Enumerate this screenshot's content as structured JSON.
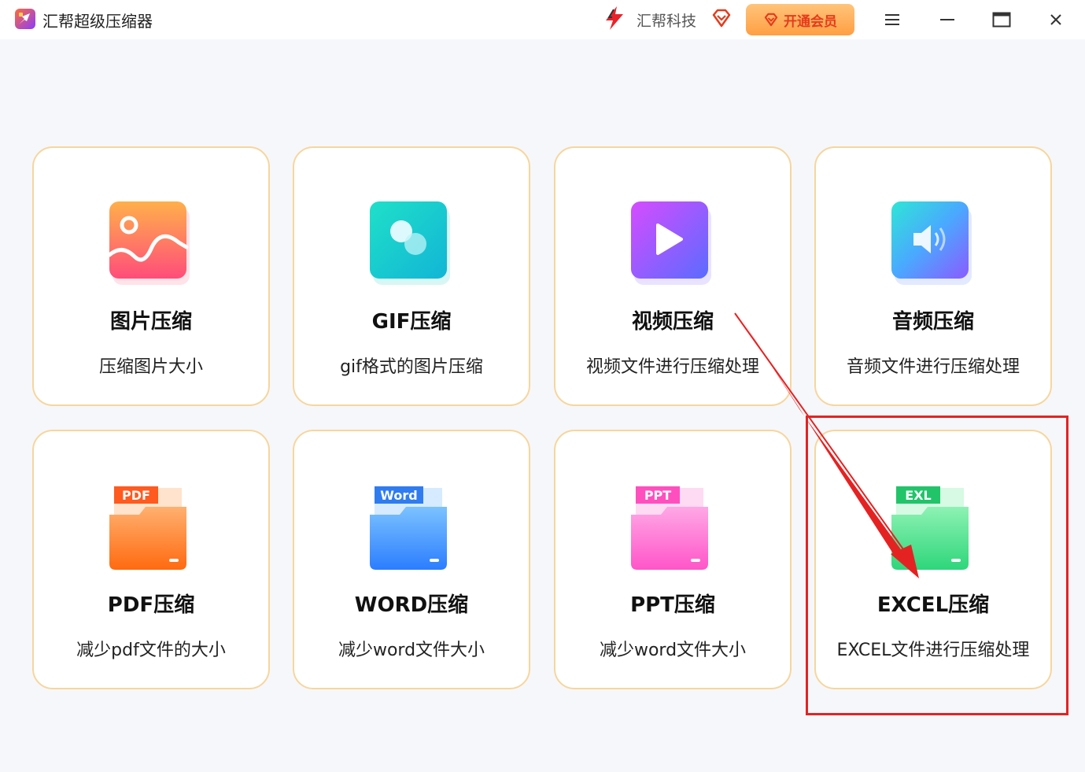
{
  "window": {
    "title": "汇帮超级压缩器",
    "brand": "汇帮科技",
    "vip_label": "开通会员",
    "controls": [
      "menu-icon",
      "minimize-icon",
      "maximize-icon",
      "close-icon"
    ]
  },
  "colors": {
    "card_border": "#f6d69c",
    "vip_bg": "#ff9f43",
    "vip_text": "#e53b1c",
    "annotation": "#e52222"
  },
  "cards": [
    {
      "title": "图片压缩",
      "desc": "压缩图片大小",
      "icon": "image-icon"
    },
    {
      "title": "GIF压缩",
      "desc": "gif格式的图片压缩",
      "icon": "gif-icon"
    },
    {
      "title": "视频压缩",
      "desc": "视频文件进行压缩处理",
      "icon": "video-play-icon"
    },
    {
      "title": "音频压缩",
      "desc": "音频文件进行压缩处理",
      "icon": "speaker-icon"
    },
    {
      "title": "PDF压缩",
      "desc": "减少pdf文件的大小",
      "icon": "pdf-folder-icon",
      "badge": "PDF"
    },
    {
      "title": "WORD压缩",
      "desc": "减少word文件大小",
      "icon": "word-folder-icon",
      "badge": "Word"
    },
    {
      "title": "PPT压缩",
      "desc": "减少word文件大小",
      "icon": "ppt-folder-icon",
      "badge": "PPT"
    },
    {
      "title": "EXCEL压缩",
      "desc": "EXCEL文件进行压缩处理",
      "icon": "excel-folder-icon",
      "badge": "EXL"
    }
  ]
}
